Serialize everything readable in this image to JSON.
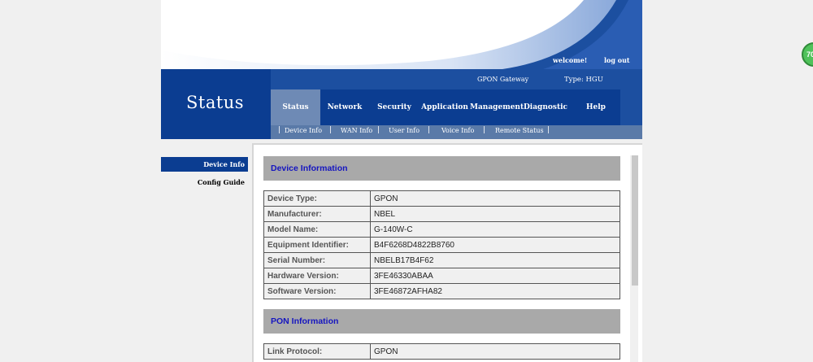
{
  "header": {
    "welcome": "welcome!",
    "logout": "log out",
    "gateway": "GPON Gateway",
    "type_label": "Type: HGU",
    "page_title": "Status"
  },
  "main_nav": [
    "Status",
    "Network",
    "Security",
    "Application",
    "Management",
    "Diagnostic",
    "Help"
  ],
  "active_tab": "Status",
  "sub_nav": [
    "Device Info",
    "WAN Info",
    "User Info",
    "Voice Info",
    "Remote Status"
  ],
  "left_menu": [
    "Device Info",
    "Config Guide"
  ],
  "device_info": {
    "title": "Device Information",
    "rows": [
      {
        "label": "Device Type:",
        "value": "GPON"
      },
      {
        "label": "Manufacturer:",
        "value": "NBEL"
      },
      {
        "label": "Model Name:",
        "value": "G-140W-C"
      },
      {
        "label": "Equipment Identifier:",
        "value": "B4F6268D4822B8760"
      },
      {
        "label": "Serial Number:",
        "value": "NBELB17B4F62"
      },
      {
        "label": "Hardware Version:",
        "value": "3FE46330ABAA"
      },
      {
        "label": "Software Version:",
        "value": "3FE46872AFHA82"
      }
    ]
  },
  "pon_info": {
    "title": "PON Information",
    "rows": [
      {
        "label": "Link Protocol:",
        "value": "GPON"
      }
    ]
  },
  "badge_text": "70",
  "colors": {
    "header_blue": "#1c4fa0",
    "nav_dark": "#0b3d91",
    "active_tab": "#6e8ab5",
    "section_head": "#a9a9a9",
    "section_title": "#1515c0"
  }
}
